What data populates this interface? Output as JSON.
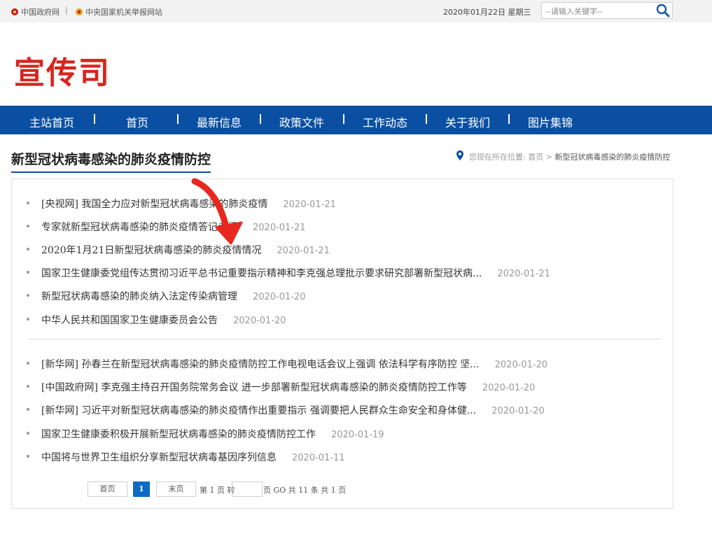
{
  "topbar": {
    "link1": "中国政府网",
    "sep": "|",
    "link2": "中央国家机关举报网站",
    "date": "2020年01月22日 星期三",
    "search_placeholder": "--请输入关键字--"
  },
  "logo": "宣传司",
  "nav": {
    "items": [
      "主站首页",
      "首页",
      "最新信息",
      "政策文件",
      "工作动态",
      "关于我们",
      "图片集锦"
    ]
  },
  "page_title": "新型冠状病毒感染的肺炎疫情防控",
  "breadcrumb": {
    "prefix": "您现在所在位置:",
    "home": "首页",
    "arrow": ">",
    "current": "新型冠状病毒感染的肺炎疫情防控"
  },
  "news": [
    {
      "title": "[央视网] 我国全力应对新型冠状病毒感染的肺炎疫情",
      "date": "2020-01-21"
    },
    {
      "title": "专家就新型冠状病毒感染的肺炎疫情答记者问",
      "date": "2020-01-21"
    },
    {
      "title": "2020年1月21日新型冠状病毒感染的肺炎疫情情况",
      "date": "2020-01-21"
    },
    {
      "title": "国家卫生健康委党组传达贯彻习近平总书记重要指示精神和李克强总理批示要求研究部署新型冠状病...",
      "date": "2020-01-21"
    },
    {
      "title": "新型冠状病毒感染的肺炎纳入法定传染病管理",
      "date": "2020-01-20"
    },
    {
      "title": "中华人民共和国国家卫生健康委员会公告",
      "date": "2020-01-20"
    },
    {
      "title": "[新华网] 孙春兰在新型冠状病毒感染的肺炎疫情防控工作电视电话会议上强调 依法科学有序防控 坚...",
      "date": "2020-01-20"
    },
    {
      "title": "[中国政府网] 李克强主持召开国务院常务会议 进一步部署新型冠状病毒感染的肺炎疫情防控工作等",
      "date": "2020-01-20"
    },
    {
      "title": "[新华网] 习近平对新型冠状病毒感染的肺炎疫情作出重要指示 强调要把人民群众生命安全和身体健...",
      "date": "2020-01-20"
    },
    {
      "title": "国家卫生健康委积极开展新型冠状病毒感染的肺炎疫情防控工作",
      "date": "2020-01-19"
    },
    {
      "title": "中国将与世界卫生组织分享新型冠状病毒基因序列信息",
      "date": "2020-01-11"
    }
  ],
  "pagination": {
    "first": "首页",
    "current": "1",
    "last": "末页",
    "page_info": "第 1 页 转",
    "go_info": "页 GO 共 11 条 共 1 页"
  },
  "colors": {
    "nav_bg": "#0b4fa2",
    "logo": "#d6251e",
    "annotation_arrow": "#e8281f",
    "page_current": "#0b6bc6"
  }
}
